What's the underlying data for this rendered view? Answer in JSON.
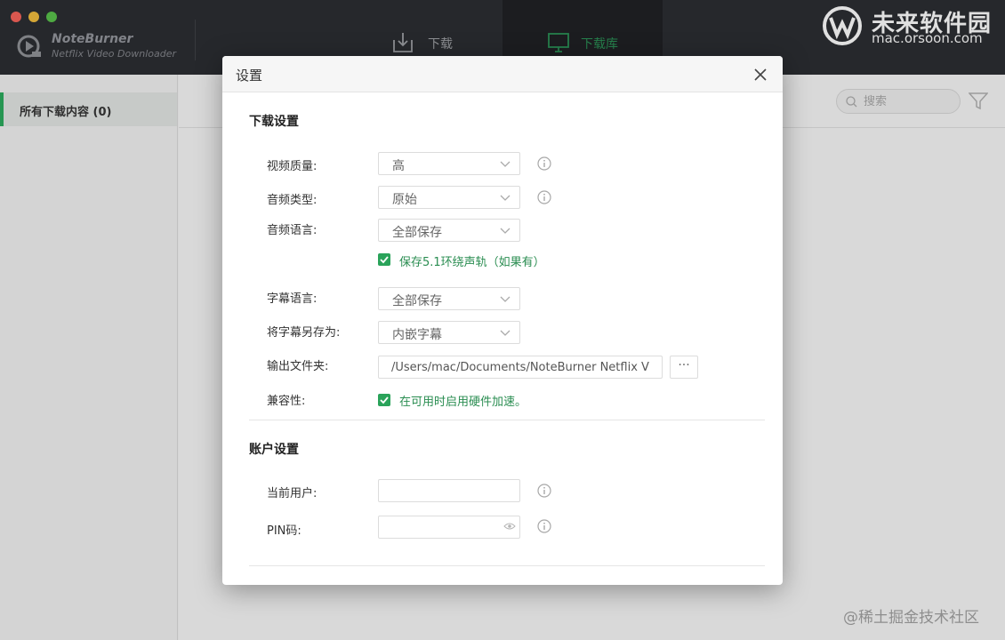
{
  "window": {
    "brand_name": "NoteBurner",
    "brand_sub": "Netflix Video Downloader",
    "tabs": [
      {
        "label": "下载",
        "icon": "download-icon",
        "active": false
      },
      {
        "label": "下载库",
        "icon": "monitor-icon",
        "active": true
      }
    ]
  },
  "watermark": {
    "title": "未来软件园",
    "url": "mac.orsoon.com",
    "bottom": "@稀土掘金技术社区"
  },
  "sidebar": {
    "items": [
      {
        "label": "所有下载内容 (0)",
        "active": true
      }
    ]
  },
  "content": {
    "search_placeholder": "搜索"
  },
  "dialog": {
    "title": "设置",
    "download_section": {
      "title": "下载设置",
      "video_quality": {
        "label": "视频质量:",
        "value": "高"
      },
      "audio_type": {
        "label": "音频类型:",
        "value": "原始"
      },
      "audio_language": {
        "label": "音频语言:",
        "value": "全部保存"
      },
      "keep_51": {
        "label": "保存5.1环绕声轨（如果有）",
        "checked": true
      },
      "subtitle_language": {
        "label": "字幕语言:",
        "value": "全部保存"
      },
      "subtitle_save_as": {
        "label": "将字幕另存为:",
        "value": "内嵌字幕"
      },
      "output_folder": {
        "label": "输出文件夹:",
        "value": "/Users/mac/Documents/NoteBurner Netflix V",
        "browse": "···"
      },
      "compatibility": {
        "label": "兼容性:",
        "option": "在可用时启用硬件加速。",
        "checked": true
      }
    },
    "account_section": {
      "title": "账户设置",
      "current_user": {
        "label": "当前用户:",
        "value": ""
      },
      "pin": {
        "label": "PIN码:",
        "value": ""
      }
    }
  },
  "colors": {
    "accent": "#2aa35a",
    "accent_text": "#2a8d51",
    "titlebar": "#2a2c30"
  }
}
